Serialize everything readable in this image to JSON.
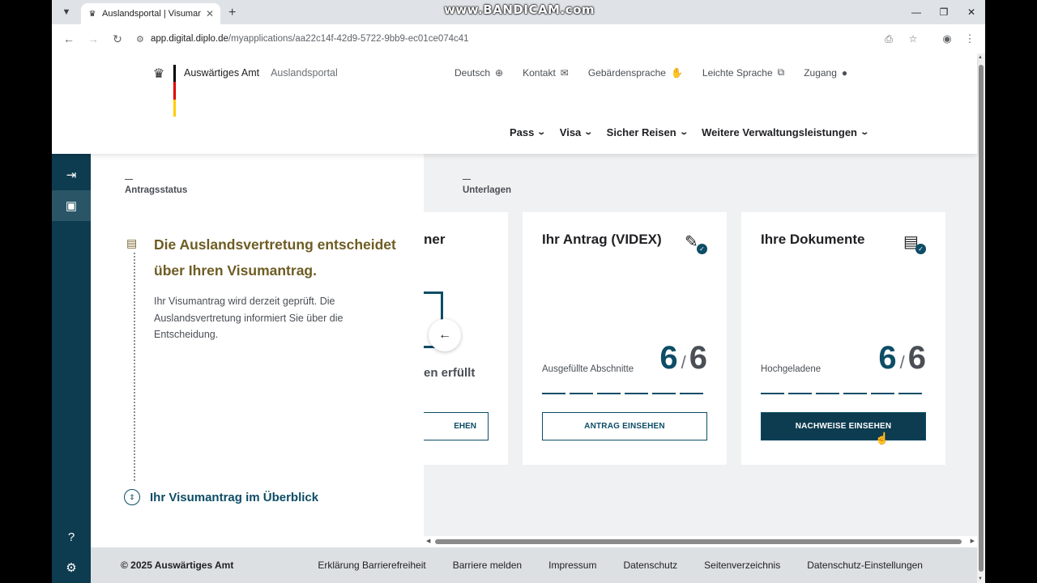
{
  "browser": {
    "tab_title": "Auslandsportal | Visumantrag",
    "url_host": "app.digital.diplo.de",
    "url_path": "/myapplications/aa22c14f-42d9-5722-9bb9-ec01ce074c41",
    "watermark": "www.BANDICAM.com"
  },
  "header": {
    "brand": "Auswärtiges Amt",
    "brand_sub": "Auslandsportal",
    "flag_colors": [
      "#000000",
      "#dd0000",
      "#ffcc00"
    ],
    "utility_links": [
      {
        "label": "Deutsch",
        "icon": "globe-icon"
      },
      {
        "label": "Kontakt",
        "icon": "mail-icon"
      },
      {
        "label": "Gebärdensprache",
        "icon": "sign-language-icon"
      },
      {
        "label": "Leichte Sprache",
        "icon": "easy-language-icon"
      },
      {
        "label": "Zugang",
        "icon": "user-icon"
      }
    ],
    "main_nav": [
      "Pass",
      "Visa",
      "Sicher Reisen",
      "Weitere Verwaltungsleistungen"
    ]
  },
  "sections": {
    "status_label": "Antragsstatus",
    "documents_label": "Unterlagen"
  },
  "status": {
    "title": "Die Auslandsvertretung entscheidet über Ihren Visumantrag.",
    "text": "Ihr Visumantrag wird derzeit geprüft. Die Auslandsvertretung informiert Sie über die Entscheidung.",
    "overview_link": "Ihr Visumantrag im Überblick"
  },
  "cards": {
    "partial": {
      "title_fragment": "ner",
      "text_fragment": "en erfüllt",
      "button_fragment": "EHEN"
    },
    "application": {
      "title": "Ihr Antrag (VIDEX)",
      "label": "Ausgefüllte Abschnitte",
      "done": "6",
      "total": "6",
      "progress": 1.0,
      "button": "ANTRAG EINSEHEN"
    },
    "documents": {
      "title": "Ihre Dokumente",
      "label": "Hochgeladene",
      "done": "6",
      "total": "6",
      "progress": 1.0,
      "button": "NACHWEISE EINSEHEN"
    }
  },
  "footer": {
    "copyright": "© 2025 Auswärtiges Amt",
    "links": [
      "Erklärung Barrierefreiheit",
      "Barriere melden",
      "Impressum",
      "Datenschutz",
      "Seitenverzeichnis",
      "Datenschutz-Einstellungen"
    ]
  },
  "colors": {
    "primary": "#0d3b4f",
    "status_title": "#6e5c23",
    "content_bg": "#f0f1f2"
  }
}
